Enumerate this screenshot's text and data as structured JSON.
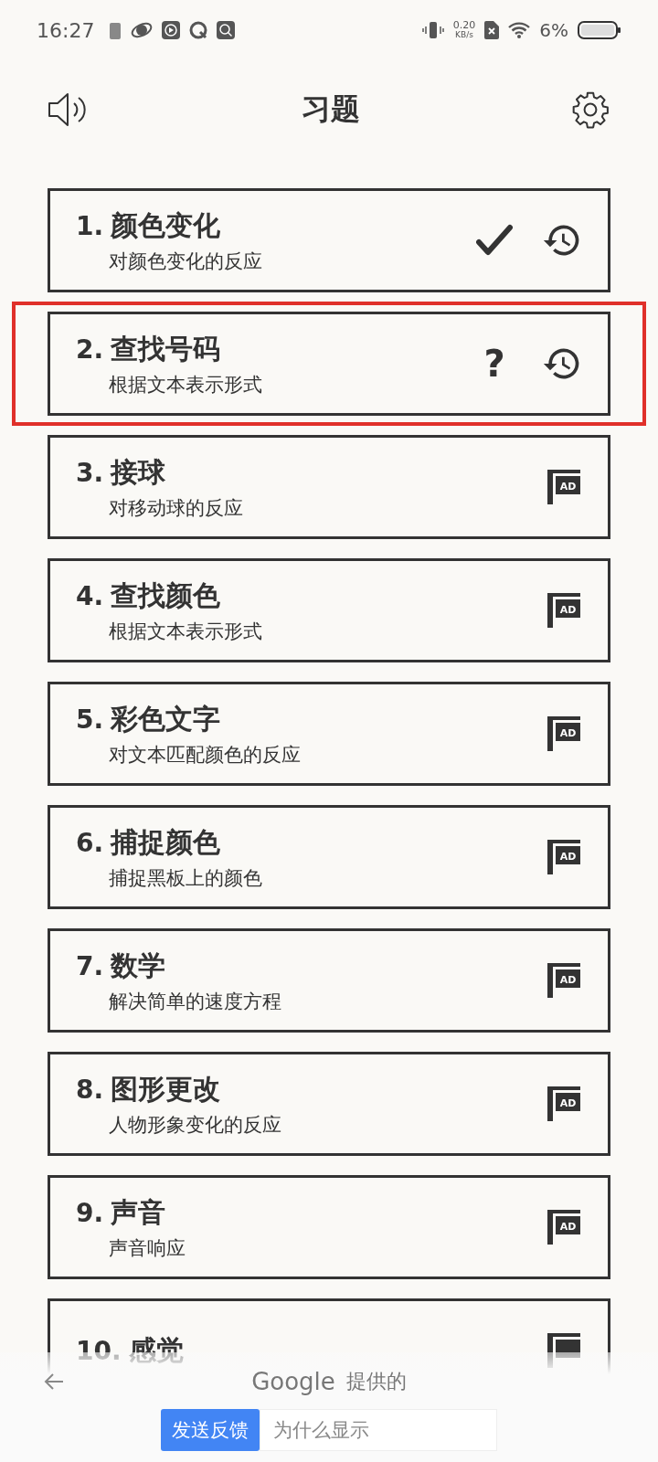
{
  "status_bar": {
    "time": "16:27",
    "speed_value": "0.20",
    "speed_unit": "KB/s",
    "battery": "6%"
  },
  "header": {
    "title": "习题"
  },
  "exercises": [
    {
      "number": "1.",
      "title": "颜色变化",
      "subtitle": "对颜色变化的反应",
      "kind": "done",
      "history": true,
      "highlighted": false
    },
    {
      "number": "2.",
      "title": "查找号码",
      "subtitle": "根据文本表示形式",
      "kind": "unknown",
      "status_label": "?",
      "history": true,
      "highlighted": true
    },
    {
      "number": "3.",
      "title": "接球",
      "subtitle": "对移动球的反应",
      "kind": "locked",
      "ad_label": "AD",
      "history": false,
      "highlighted": false
    },
    {
      "number": "4.",
      "title": "查找颜色",
      "subtitle": "根据文本表示形式",
      "kind": "locked",
      "ad_label": "AD",
      "history": false,
      "highlighted": false
    },
    {
      "number": "5.",
      "title": "彩色文字",
      "subtitle": "对文本匹配颜色的反应",
      "kind": "locked",
      "ad_label": "AD",
      "history": false,
      "highlighted": false
    },
    {
      "number": "6.",
      "title": "捕捉颜色",
      "subtitle": "捕捉黑板上的颜色",
      "kind": "locked",
      "ad_label": "AD",
      "history": false,
      "highlighted": false
    },
    {
      "number": "7.",
      "title": "数学",
      "subtitle": "解决简单的速度方程",
      "kind": "locked",
      "ad_label": "AD",
      "history": false,
      "highlighted": false
    },
    {
      "number": "8.",
      "title": "图形更改",
      "subtitle": "人物形象变化的反应",
      "kind": "locked",
      "ad_label": "AD",
      "history": false,
      "highlighted": false
    },
    {
      "number": "9.",
      "title": "声音",
      "subtitle": "声音响应",
      "kind": "locked",
      "ad_label": "AD",
      "history": false,
      "highlighted": false
    },
    {
      "number": "10.",
      "title": "感觉",
      "kind": "locked",
      "history": false,
      "highlighted": false
    }
  ],
  "ad_bar": {
    "brand": "Google",
    "provided": "提供的",
    "feedback_button": "发送反馈",
    "why_field": "为什么显示"
  }
}
